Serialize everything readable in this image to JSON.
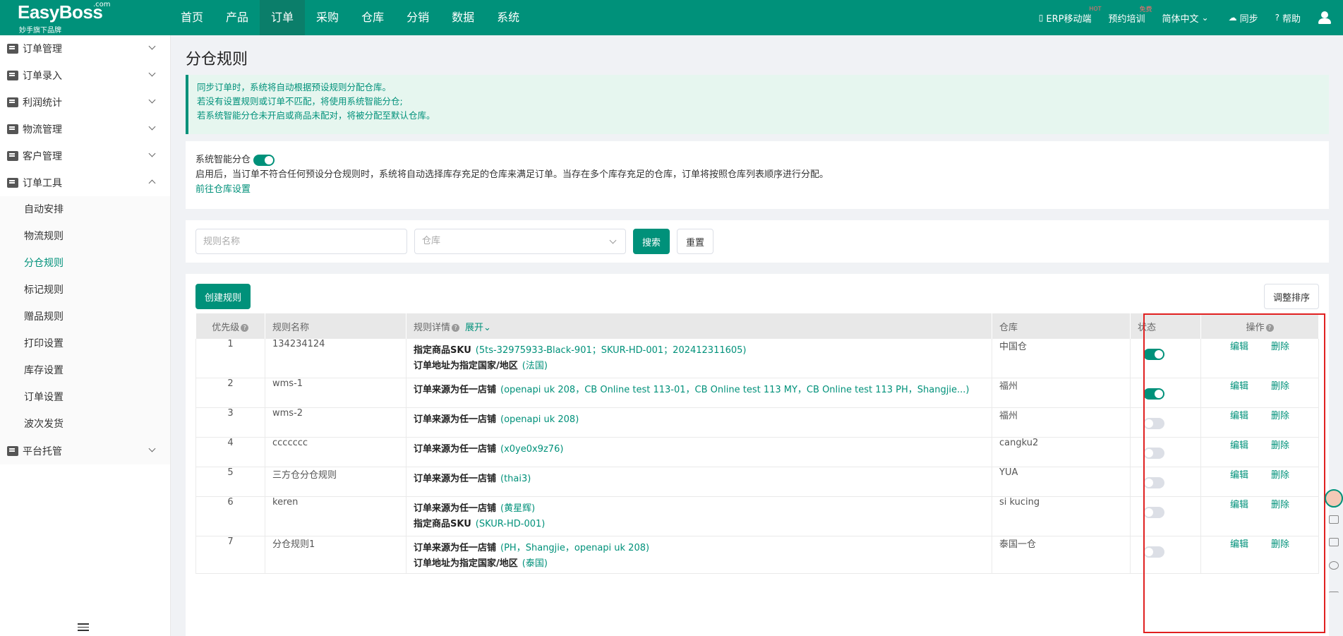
{
  "app": {
    "logo_main": "EasyBoss",
    "logo_com": ".com",
    "logo_sub": "妙手旗下品牌"
  },
  "nav": {
    "items": [
      "首页",
      "产品",
      "订单",
      "采购",
      "仓库",
      "分销",
      "数据",
      "系统"
    ],
    "active": "订单"
  },
  "top_right": {
    "erp_mobile": "ERP移动端",
    "erp_badge": "HOT",
    "training": "预约培训",
    "training_badge": "免费",
    "language": "简体中文",
    "sync": "同步",
    "help": "帮助"
  },
  "sidebar": {
    "groups": [
      {
        "label": "订单管理"
      },
      {
        "label": "订单录入"
      },
      {
        "label": "利润统计"
      },
      {
        "label": "物流管理"
      },
      {
        "label": "客户管理"
      },
      {
        "label": "订单工具"
      }
    ],
    "tool_items": [
      "自动安排",
      "物流规则",
      "分仓规则",
      "标记规则",
      "赠品规则",
      "打印设置",
      "库存设置",
      "订单设置",
      "波次发货"
    ],
    "active_item": "分仓规则",
    "last_group": "平台托管"
  },
  "page": {
    "title": "分仓规则",
    "notice_lines": [
      "同步订单时，系统将自动根据预设规则分配仓库。",
      "若没有设置规则或订单不匹配，将使用系统智能分仓;",
      "若系统智能分仓未开启或商品未配对，将被分配至默认仓库。"
    ],
    "smart": {
      "label": "系统智能分仓",
      "enabled": true,
      "desc": "启用后，当订单不符合任何预设分仓规则时，系统将自动选择库存充足的仓库来满足订单。当存在多个库存充足的仓库，订单将按照仓库列表顺序进行分配。",
      "link": "前往仓库设置"
    },
    "search": {
      "name_placeholder": "规则名称",
      "warehouse_placeholder": "仓库",
      "search_btn": "搜索",
      "reset_btn": "重置"
    },
    "create_btn": "创建规则",
    "sort_btn": "调整排序",
    "table": {
      "headers": {
        "priority": "优先级",
        "name": "规则名称",
        "detail": "规则详情",
        "expand": "展开",
        "warehouse": "仓库",
        "status": "状态",
        "ops": "操作"
      },
      "edit": "编辑",
      "delete": "删除",
      "rows": [
        {
          "priority": "1",
          "name": "134234124",
          "warehouse": "中国仓",
          "status": true,
          "details": [
            {
              "k": "指定商品SKU",
              "v": "(5ts-32975933-Black-901；SKUR-HD-001；202412311605)"
            },
            {
              "k": "订单地址为指定国家/地区",
              "v": "(法国)"
            }
          ]
        },
        {
          "priority": "2",
          "name": "wms-1",
          "warehouse": "福州",
          "status": true,
          "details": [
            {
              "k": "订单来源为任一店铺",
              "v": "(openapi uk 208，CB Online test 113-01，CB Online test 113 MY，CB Online test 113 PH，Shangjie...)"
            }
          ]
        },
        {
          "priority": "3",
          "name": "wms-2",
          "warehouse": "福州",
          "status": false,
          "details": [
            {
              "k": "订单来源为任一店铺",
              "v": "(openapi uk 208)"
            }
          ]
        },
        {
          "priority": "4",
          "name": "ccccccc",
          "warehouse": "cangku2",
          "status": false,
          "details": [
            {
              "k": "订单来源为任一店铺",
              "v": "(x0ye0x9z76)"
            }
          ]
        },
        {
          "priority": "5",
          "name": "三方仓分仓规则",
          "warehouse": "YUA",
          "status": false,
          "details": [
            {
              "k": "订单来源为任一店铺",
              "v": "(thai3)"
            }
          ]
        },
        {
          "priority": "6",
          "name": "keren",
          "warehouse": "si kucing",
          "status": false,
          "details": [
            {
              "k": "订单来源为任一店铺",
              "v": "(黄星辉)"
            },
            {
              "k": "指定商品SKU",
              "v": "(SKUR-HD-001)"
            }
          ]
        },
        {
          "priority": "7",
          "name": "分仓规则1",
          "warehouse": "泰国一仓",
          "status": false,
          "details": [
            {
              "k": "订单来源为任一店铺",
              "v": "(PH，Shangjie，openapi uk 208)"
            },
            {
              "k": "订单地址为指定国家/地区",
              "v": "(泰国)"
            }
          ]
        }
      ]
    }
  },
  "colors": {
    "brand": "#00917a",
    "highlight": "#e02020"
  }
}
